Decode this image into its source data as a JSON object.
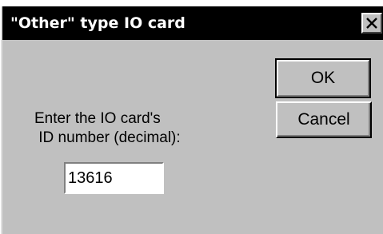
{
  "dialog": {
    "title": "\"Other\" type IO card",
    "close_icon": "close-icon",
    "prompt_line1": "Enter the IO card's",
    "prompt_line2": " ID number (decimal):",
    "id_value": "13616",
    "ok_label": "OK",
    "cancel_label": "Cancel"
  },
  "colors": {
    "dialog_bg": "#c0c0c0",
    "titlebar_bg": "#000000",
    "title_text": "#ffffff",
    "input_bg": "#ffffff"
  }
}
